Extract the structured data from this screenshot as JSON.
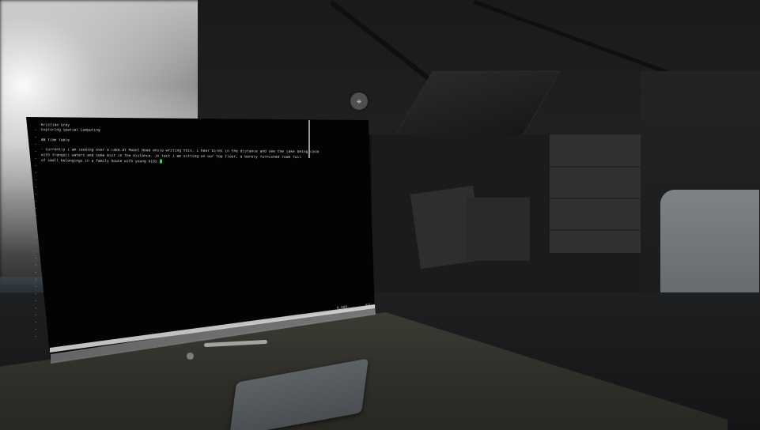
{
  "scene": {
    "environment": "spatial-computing-room",
    "pin_icon": "pin-icon",
    "pin_glyph": "⌖"
  },
  "terminal": {
    "lines": [
      "Kristian Gray",
      "Exploring Spatial Computing",
      "",
      "## Time Table",
      "",
      "- Currently I am looking over a lake at Mount Hood while writing this. I hear birds in the distance and see the lake being calm",
      "  with tranquil waters and some mist in the distance. In fact I am sitting on our top floor, a barely furnished room full",
      "  of small belongings in a family house with young kids."
    ],
    "status_left": "0,000",
    "status_right": "All"
  },
  "colors": {
    "terminal_bg": "#030303",
    "terminal_text": "#d8d8d8",
    "cursor": "#3ecf5a",
    "status_bar": "#d6d6d6"
  }
}
